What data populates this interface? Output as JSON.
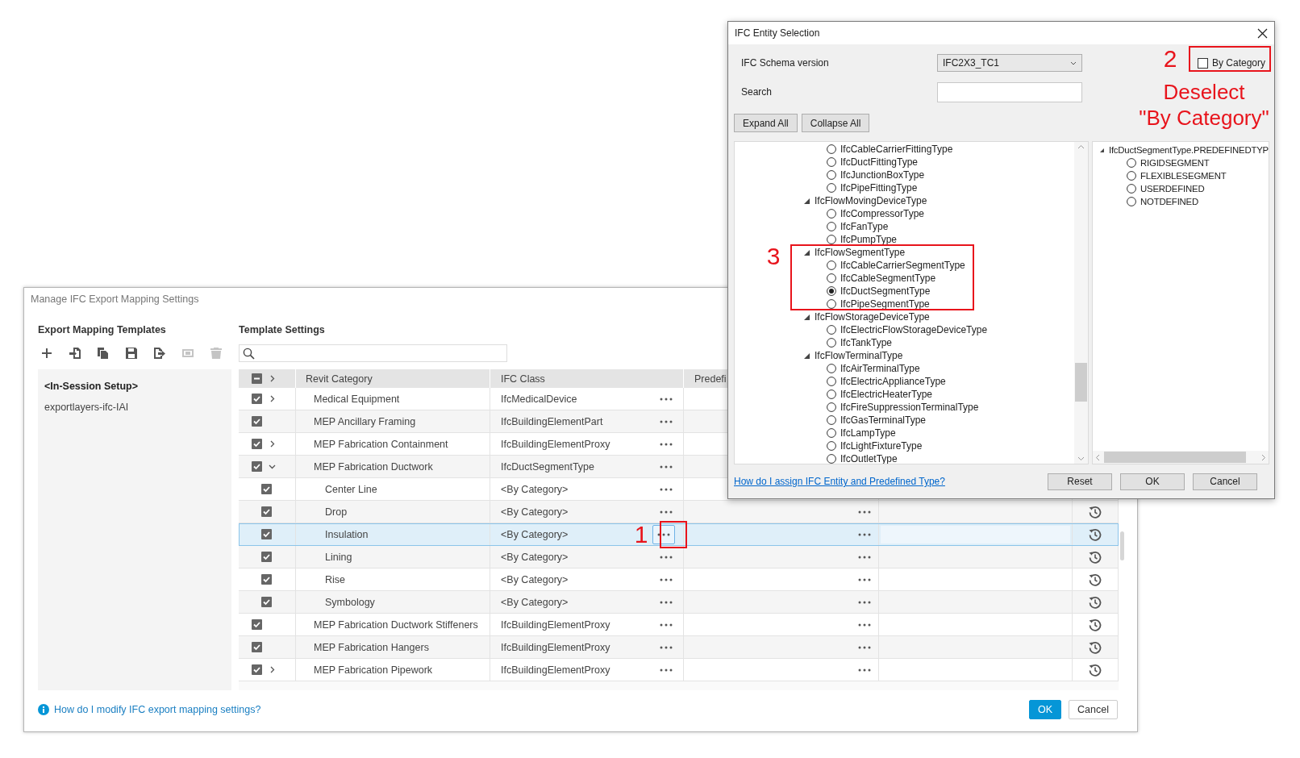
{
  "main_window": {
    "title": "Manage IFC Export Mapping Settings",
    "templates": {
      "heading": "Export Mapping Templates",
      "toolbar": [
        {
          "kind": "add",
          "disabled": false
        },
        {
          "kind": "import",
          "disabled": false
        },
        {
          "kind": "copy",
          "disabled": false
        },
        {
          "kind": "save",
          "disabled": false
        },
        {
          "kind": "export",
          "disabled": false
        },
        {
          "kind": "rename",
          "disabled": true
        },
        {
          "kind": "delete",
          "disabled": true
        }
      ],
      "items": [
        {
          "label": "<In-Session Setup>",
          "selected": true
        },
        {
          "label": "exportlayers-ifc-IAI",
          "selected": false
        }
      ]
    },
    "settings": {
      "heading": "Template Settings",
      "table": {
        "header_checked": true,
        "header_partial": true,
        "columns": [
          "Revit Category",
          "IFC Class",
          "Predefi"
        ],
        "rows": [
          {
            "category": "Medical Equipment",
            "ifc_class": "IfcMedicalDevice",
            "checked": true,
            "expandable": true,
            "expanded": false,
            "selected": false
          },
          {
            "category": "MEP Ancillary Framing",
            "ifc_class": "IfcBuildingElementPart",
            "checked": true,
            "expandable": false,
            "expanded": false,
            "selected": false
          },
          {
            "category": "MEP Fabrication Containment",
            "ifc_class": "IfcBuildingElementProxy",
            "checked": true,
            "expandable": true,
            "expanded": false,
            "selected": false
          },
          {
            "category": "MEP Fabrication Ductwork",
            "ifc_class": "IfcDuctSegmentType",
            "checked": true,
            "expandable": true,
            "expanded": true,
            "selected": false,
            "children": [
              {
                "category": "Center Line",
                "ifc_class": "<By Category>",
                "checked": true,
                "selected": false
              },
              {
                "category": "Drop",
                "ifc_class": "<By Category>",
                "checked": true,
                "selected": false,
                "predefined_button": true
              },
              {
                "category": "Insulation",
                "ifc_class": "<By Category>",
                "checked": true,
                "selected": true,
                "predefined_button": true
              },
              {
                "category": "Lining",
                "ifc_class": "<By Category>",
                "checked": true,
                "selected": false,
                "predefined_button": true
              },
              {
                "category": "Rise",
                "ifc_class": "<By Category>",
                "checked": true,
                "selected": false,
                "predefined_button": true
              },
              {
                "category": "Symbology",
                "ifc_class": "<By Category>",
                "checked": true,
                "selected": false,
                "predefined_button": true
              }
            ]
          },
          {
            "category": "MEP Fabrication Ductwork Stiffeners",
            "ifc_class": "IfcBuildingElementProxy",
            "checked": true,
            "expandable": false,
            "expanded": false,
            "selected": false,
            "predefined_button": true
          },
          {
            "category": "MEP Fabrication Hangers",
            "ifc_class": "IfcBuildingElementProxy",
            "checked": true,
            "expandable": false,
            "expanded": false,
            "selected": false,
            "predefined_button": true
          },
          {
            "category": "MEP Fabrication Pipework",
            "ifc_class": "IfcBuildingElementProxy",
            "checked": true,
            "expandable": true,
            "expanded": false,
            "selected": false,
            "predefined_button": true
          }
        ]
      }
    },
    "help_link": "How do I modify IFC export mapping settings?",
    "buttons": [
      {
        "label": "OK",
        "kind": "primary"
      },
      {
        "label": "Cancel",
        "kind": "secondary"
      }
    ]
  },
  "dialog": {
    "title": "IFC Entity Selection",
    "schema": {
      "label": "IFC Schema version",
      "value": "IFC2X3_TC1"
    },
    "by_category": {
      "label": "By Category",
      "checked": false
    },
    "search": {
      "label": "Search"
    },
    "tree_buttons": [
      "Expand All",
      "Collapse All"
    ],
    "entity_tree": [
      {
        "children": [
          {
            "label": "IfcCableCarrierFittingType",
            "selected": false
          },
          {
            "label": "IfcDuctFittingType",
            "selected": false
          },
          {
            "label": "IfcJunctionBoxType",
            "selected": false
          },
          {
            "label": "IfcPipeFittingType",
            "selected": false
          }
        ]
      },
      {
        "label": "IfcFlowMovingDeviceType",
        "expanded": true,
        "children": [
          {
            "label": "IfcCompressorType",
            "selected": false
          },
          {
            "label": "IfcFanType",
            "selected": false
          },
          {
            "label": "IfcPumpType",
            "selected": false
          }
        ]
      },
      {
        "label": "IfcFlowSegmentType",
        "expanded": true,
        "children": [
          {
            "label": "IfcCableCarrierSegmentType",
            "selected": false
          },
          {
            "label": "IfcCableSegmentType",
            "selected": false
          },
          {
            "label": "IfcDuctSegmentType",
            "selected": true
          },
          {
            "label": "IfcPipeSegmentType",
            "selected": false
          }
        ]
      },
      {
        "label": "IfcFlowStorageDeviceType",
        "expanded": true,
        "children": [
          {
            "label": "IfcElectricFlowStorageDeviceType",
            "selected": false
          },
          {
            "label": "IfcTankType",
            "selected": false
          }
        ]
      },
      {
        "label": "IfcFlowTerminalType",
        "expanded": true,
        "children": [
          {
            "label": "IfcAirTerminalType",
            "selected": false
          },
          {
            "label": "IfcElectricApplianceType",
            "selected": false
          },
          {
            "label": "IfcElectricHeaterType",
            "selected": false
          },
          {
            "label": "IfcFireSuppressionTerminalType",
            "selected": false
          },
          {
            "label": "IfcGasTerminalType",
            "selected": false
          },
          {
            "label": "IfcLampType",
            "selected": false
          },
          {
            "label": "IfcLightFixtureType",
            "selected": false
          },
          {
            "label": "IfcOutletType",
            "selected": false
          }
        ]
      }
    ],
    "predefined_tree": [
      {
        "label": "IfcDuctSegmentType.PREDEFINEDTYP",
        "expanded": true,
        "children": [
          {
            "label": "RIGIDSEGMENT",
            "selected": false
          },
          {
            "label": "FLEXIBLESEGMENT",
            "selected": false
          },
          {
            "label": "USERDEFINED",
            "selected": false
          },
          {
            "label": "NOTDEFINED",
            "selected": false
          }
        ]
      }
    ],
    "help_link": "How do I assign IFC Entity and Predefined Type?",
    "footer_buttons": [
      "Reset",
      "OK",
      "Cancel"
    ]
  },
  "annotations": [
    {
      "kind": "box"
    },
    {
      "kind": "number",
      "text": "1"
    },
    {
      "kind": "box"
    },
    {
      "kind": "number",
      "text": "2"
    },
    {
      "kind": "note",
      "text": "Deselect\n\"By Category\""
    },
    {
      "kind": "box"
    },
    {
      "kind": "number",
      "text": "3"
    }
  ]
}
